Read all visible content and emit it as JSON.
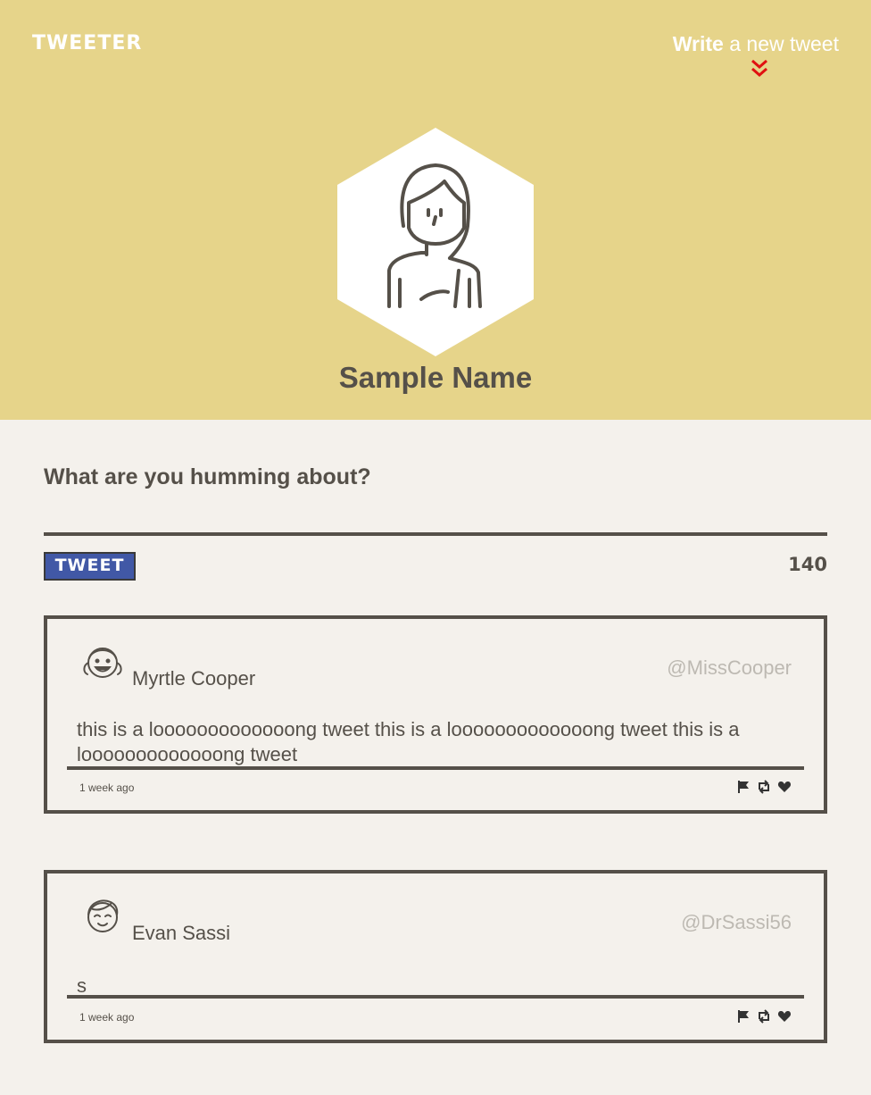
{
  "header": {
    "logo": "TWEETER",
    "compose_bold": "Write",
    "compose_rest": " a new tweet",
    "profile_name": "Sample Name",
    "accent_color": "#e6d48a"
  },
  "composer": {
    "prompt": "What are you humming about?",
    "input_value": "",
    "button_label": "TWEET",
    "counter": "140",
    "button_color": "#4158a6"
  },
  "tweets": [
    {
      "name": "Myrtle Cooper",
      "handle": "@MissCooper",
      "text": "this is a looooooooooooong tweet this is a looooooooooooong tweet this is a looooooooooooong tweet",
      "time": "1 week ago",
      "icons": [
        "flag-icon",
        "retweet-icon",
        "heart-icon"
      ]
    },
    {
      "name": "Evan Sassi",
      "handle": "@DrSassi56",
      "text": "s",
      "time": "1 week ago",
      "icons": [
        "flag-icon",
        "retweet-icon",
        "heart-icon"
      ]
    }
  ]
}
